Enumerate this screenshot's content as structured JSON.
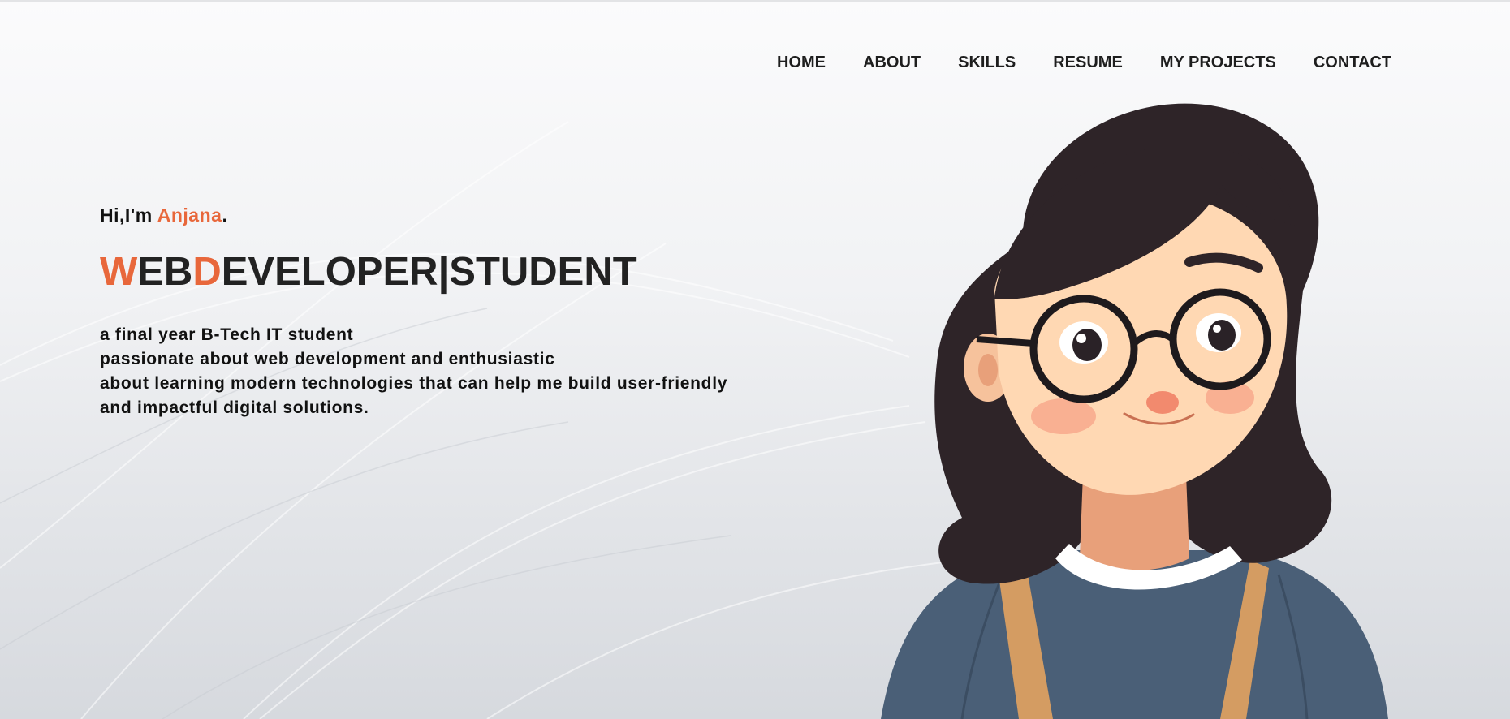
{
  "nav": {
    "items": [
      "HOME",
      "ABOUT",
      "SKILLS",
      "RESUME",
      "MY PROJECTS",
      "CONTACT"
    ]
  },
  "hero": {
    "greeting_prefix": "Hi,I'm ",
    "name": "Anjana",
    "greeting_suffix": ".",
    "title_parts": [
      "W",
      "EB",
      "D",
      "EVELOPER|STUDENT"
    ],
    "bio_lines": [
      "a final year B-Tech IT student",
      "passionate about web development and enthusiastic",
      "about learning modern technologies that can help me build user-friendly",
      "and impactful digital solutions."
    ]
  },
  "illustration": {
    "icon": "avatar-illustration"
  },
  "colors": {
    "accent": "#e8673b",
    "text": "#1e1e1e",
    "hair": "#2e2428",
    "shirt": "#4a5f77"
  }
}
